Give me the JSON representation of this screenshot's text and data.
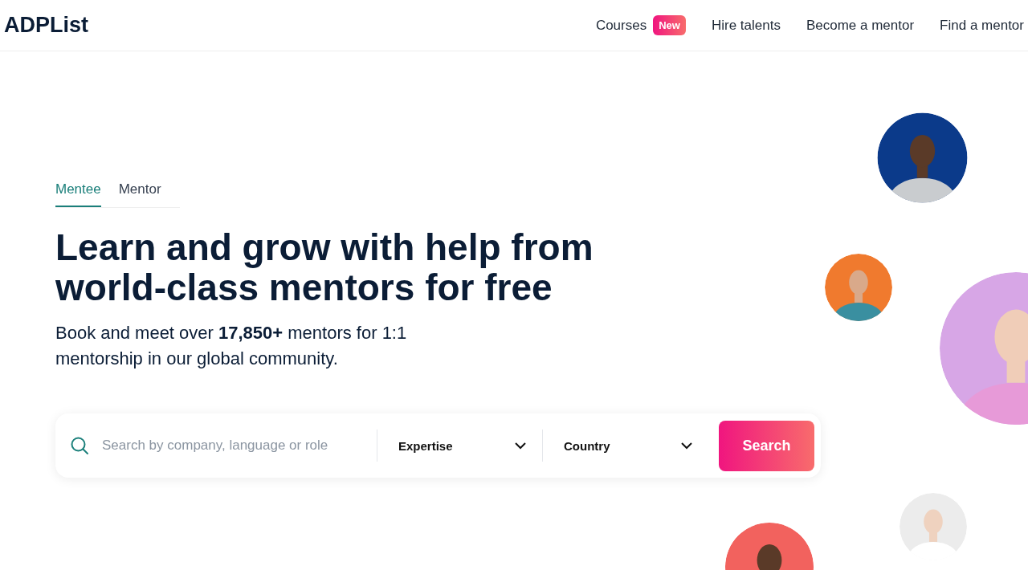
{
  "logo": "ADPList",
  "nav": [
    {
      "label": "Courses",
      "badge": "New"
    },
    {
      "label": "Hire talents"
    },
    {
      "label": "Become a mentor"
    },
    {
      "label": "Find a mentor"
    }
  ],
  "tabs": [
    {
      "label": "Mentee",
      "selected": true
    },
    {
      "label": "Mentor",
      "selected": false
    }
  ],
  "headline": "Learn and grow with help from world-class mentors for free",
  "subtitle": "Book and meet over **17,850+** mentors for 1:1 mentorship in our global community.",
  "search": {
    "placeholder": "Search by company, language or role",
    "dropdowns": [
      "Expertise",
      "Country"
    ],
    "button": "Search"
  }
}
